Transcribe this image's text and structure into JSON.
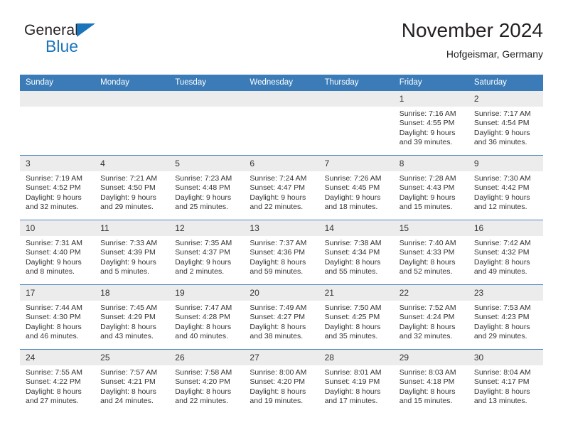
{
  "brand": {
    "name_top": "General",
    "name_bottom": "Blue",
    "triangle_color": "#1b75bb"
  },
  "header": {
    "title": "November 2024",
    "subtitle": "Hofgeismar, Germany"
  },
  "colors": {
    "header_row": "#3b7cb8",
    "daynum_band": "#ececec",
    "row_divider": "#4a84bd",
    "text": "#333333"
  },
  "weekday_headers": [
    "Sunday",
    "Monday",
    "Tuesday",
    "Wednesday",
    "Thursday",
    "Friday",
    "Saturday"
  ],
  "weeks": [
    [
      {
        "day": "",
        "empty": true
      },
      {
        "day": "",
        "empty": true
      },
      {
        "day": "",
        "empty": true
      },
      {
        "day": "",
        "empty": true
      },
      {
        "day": "",
        "empty": true
      },
      {
        "day": "1",
        "sunrise": "Sunrise: 7:16 AM",
        "sunset": "Sunset: 4:55 PM",
        "daylight": "Daylight: 9 hours and 39 minutes."
      },
      {
        "day": "2",
        "sunrise": "Sunrise: 7:17 AM",
        "sunset": "Sunset: 4:54 PM",
        "daylight": "Daylight: 9 hours and 36 minutes."
      }
    ],
    [
      {
        "day": "3",
        "sunrise": "Sunrise: 7:19 AM",
        "sunset": "Sunset: 4:52 PM",
        "daylight": "Daylight: 9 hours and 32 minutes."
      },
      {
        "day": "4",
        "sunrise": "Sunrise: 7:21 AM",
        "sunset": "Sunset: 4:50 PM",
        "daylight": "Daylight: 9 hours and 29 minutes."
      },
      {
        "day": "5",
        "sunrise": "Sunrise: 7:23 AM",
        "sunset": "Sunset: 4:48 PM",
        "daylight": "Daylight: 9 hours and 25 minutes."
      },
      {
        "day": "6",
        "sunrise": "Sunrise: 7:24 AM",
        "sunset": "Sunset: 4:47 PM",
        "daylight": "Daylight: 9 hours and 22 minutes."
      },
      {
        "day": "7",
        "sunrise": "Sunrise: 7:26 AM",
        "sunset": "Sunset: 4:45 PM",
        "daylight": "Daylight: 9 hours and 18 minutes."
      },
      {
        "day": "8",
        "sunrise": "Sunrise: 7:28 AM",
        "sunset": "Sunset: 4:43 PM",
        "daylight": "Daylight: 9 hours and 15 minutes."
      },
      {
        "day": "9",
        "sunrise": "Sunrise: 7:30 AM",
        "sunset": "Sunset: 4:42 PM",
        "daylight": "Daylight: 9 hours and 12 minutes."
      }
    ],
    [
      {
        "day": "10",
        "sunrise": "Sunrise: 7:31 AM",
        "sunset": "Sunset: 4:40 PM",
        "daylight": "Daylight: 9 hours and 8 minutes."
      },
      {
        "day": "11",
        "sunrise": "Sunrise: 7:33 AM",
        "sunset": "Sunset: 4:39 PM",
        "daylight": "Daylight: 9 hours and 5 minutes."
      },
      {
        "day": "12",
        "sunrise": "Sunrise: 7:35 AM",
        "sunset": "Sunset: 4:37 PM",
        "daylight": "Daylight: 9 hours and 2 minutes."
      },
      {
        "day": "13",
        "sunrise": "Sunrise: 7:37 AM",
        "sunset": "Sunset: 4:36 PM",
        "daylight": "Daylight: 8 hours and 59 minutes."
      },
      {
        "day": "14",
        "sunrise": "Sunrise: 7:38 AM",
        "sunset": "Sunset: 4:34 PM",
        "daylight": "Daylight: 8 hours and 55 minutes."
      },
      {
        "day": "15",
        "sunrise": "Sunrise: 7:40 AM",
        "sunset": "Sunset: 4:33 PM",
        "daylight": "Daylight: 8 hours and 52 minutes."
      },
      {
        "day": "16",
        "sunrise": "Sunrise: 7:42 AM",
        "sunset": "Sunset: 4:32 PM",
        "daylight": "Daylight: 8 hours and 49 minutes."
      }
    ],
    [
      {
        "day": "17",
        "sunrise": "Sunrise: 7:44 AM",
        "sunset": "Sunset: 4:30 PM",
        "daylight": "Daylight: 8 hours and 46 minutes."
      },
      {
        "day": "18",
        "sunrise": "Sunrise: 7:45 AM",
        "sunset": "Sunset: 4:29 PM",
        "daylight": "Daylight: 8 hours and 43 minutes."
      },
      {
        "day": "19",
        "sunrise": "Sunrise: 7:47 AM",
        "sunset": "Sunset: 4:28 PM",
        "daylight": "Daylight: 8 hours and 40 minutes."
      },
      {
        "day": "20",
        "sunrise": "Sunrise: 7:49 AM",
        "sunset": "Sunset: 4:27 PM",
        "daylight": "Daylight: 8 hours and 38 minutes."
      },
      {
        "day": "21",
        "sunrise": "Sunrise: 7:50 AM",
        "sunset": "Sunset: 4:25 PM",
        "daylight": "Daylight: 8 hours and 35 minutes."
      },
      {
        "day": "22",
        "sunrise": "Sunrise: 7:52 AM",
        "sunset": "Sunset: 4:24 PM",
        "daylight": "Daylight: 8 hours and 32 minutes."
      },
      {
        "day": "23",
        "sunrise": "Sunrise: 7:53 AM",
        "sunset": "Sunset: 4:23 PM",
        "daylight": "Daylight: 8 hours and 29 minutes."
      }
    ],
    [
      {
        "day": "24",
        "sunrise": "Sunrise: 7:55 AM",
        "sunset": "Sunset: 4:22 PM",
        "daylight": "Daylight: 8 hours and 27 minutes."
      },
      {
        "day": "25",
        "sunrise": "Sunrise: 7:57 AM",
        "sunset": "Sunset: 4:21 PM",
        "daylight": "Daylight: 8 hours and 24 minutes."
      },
      {
        "day": "26",
        "sunrise": "Sunrise: 7:58 AM",
        "sunset": "Sunset: 4:20 PM",
        "daylight": "Daylight: 8 hours and 22 minutes."
      },
      {
        "day": "27",
        "sunrise": "Sunrise: 8:00 AM",
        "sunset": "Sunset: 4:20 PM",
        "daylight": "Daylight: 8 hours and 19 minutes."
      },
      {
        "day": "28",
        "sunrise": "Sunrise: 8:01 AM",
        "sunset": "Sunset: 4:19 PM",
        "daylight": "Daylight: 8 hours and 17 minutes."
      },
      {
        "day": "29",
        "sunrise": "Sunrise: 8:03 AM",
        "sunset": "Sunset: 4:18 PM",
        "daylight": "Daylight: 8 hours and 15 minutes."
      },
      {
        "day": "30",
        "sunrise": "Sunrise: 8:04 AM",
        "sunset": "Sunset: 4:17 PM",
        "daylight": "Daylight: 8 hours and 13 minutes."
      }
    ]
  ]
}
